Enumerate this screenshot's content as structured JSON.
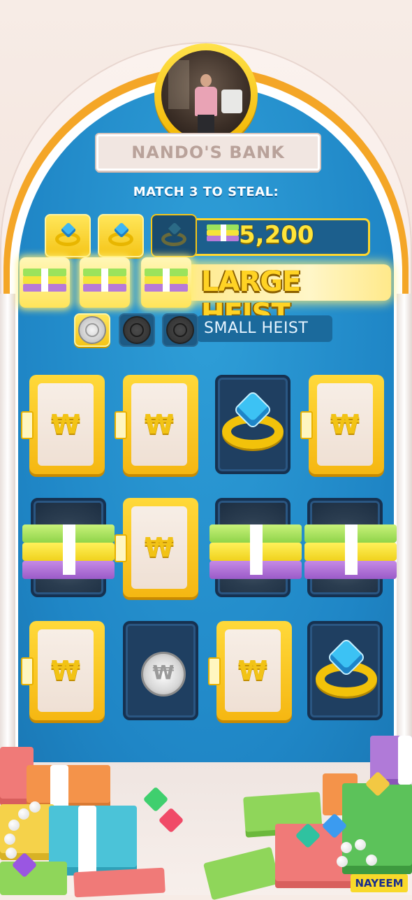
{
  "bank": {
    "title": "NANDO'S BANK"
  },
  "match": {
    "title": "MATCH 3 TO STEAL:"
  },
  "rewards": [
    {
      "tier": "ring",
      "icons": [
        "ring-icon",
        "ring-icon",
        "ring-icon"
      ],
      "matched": 2,
      "label": "5,200",
      "reward_icon": "cash-stack-icon"
    },
    {
      "tier": "cash",
      "icons": [
        "cash-stack-icon",
        "cash-stack-icon",
        "cash-stack-icon"
      ],
      "matched": 3,
      "label": "LARGE HEIST"
    },
    {
      "tier": "coin",
      "icons": [
        "coin-icon",
        "coin-icon",
        "coin-icon"
      ],
      "matched": 1,
      "label": "SMALL HEIST"
    }
  ],
  "grid": {
    "rows": 3,
    "cols": 4,
    "cards": [
      {
        "state": "closed",
        "symbol": "₩"
      },
      {
        "state": "closed",
        "symbol": "₩"
      },
      {
        "state": "open",
        "item": "ring-icon"
      },
      {
        "state": "closed",
        "symbol": "₩"
      },
      {
        "state": "open",
        "item": "cash-stack-icon"
      },
      {
        "state": "closed",
        "symbol": "₩"
      },
      {
        "state": "open",
        "item": "cash-stack-icon"
      },
      {
        "state": "open",
        "item": "cash-stack-icon"
      },
      {
        "state": "closed",
        "symbol": "₩"
      },
      {
        "state": "open",
        "item": "coin-icon"
      },
      {
        "state": "closed",
        "symbol": "₩"
      },
      {
        "state": "open",
        "item": "ring-icon"
      }
    ]
  },
  "watermark": "NAYEEM",
  "colors": {
    "board_blue": "#1f86c6",
    "gold": "#f5c518",
    "arch_orange": "#f4a627"
  }
}
